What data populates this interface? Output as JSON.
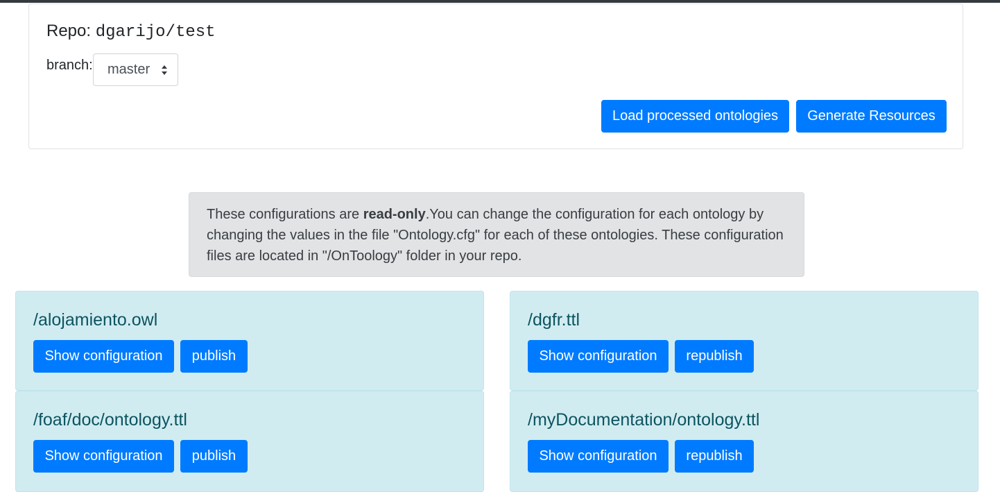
{
  "repo": {
    "label": "Repo:",
    "name": "dgarijo/test",
    "branch_label": "branch:",
    "branch_selected": "master",
    "load_button": "Load processed ontologies",
    "generate_button": "Generate Resources"
  },
  "notice": {
    "text_before": "These configurations are ",
    "bold": "read-only",
    "text_after": ".You can change the configuration for each ontology by changing the values in the file \"Ontology.cfg\" for each of these ontologies. These configuration files are located in \"/OnToology\" folder in your repo."
  },
  "ontologies": [
    {
      "path": "/alojamiento.owl",
      "show_label": "Show configuration",
      "action_label": "publish"
    },
    {
      "path": "/dgfr.ttl",
      "show_label": "Show configuration",
      "action_label": "republish"
    },
    {
      "path": "/foaf/doc/ontology.ttl",
      "show_label": "Show configuration",
      "action_label": "publish"
    },
    {
      "path": "/myDocumentation/ontology.ttl",
      "show_label": "Show configuration",
      "action_label": "republish"
    }
  ],
  "colors": {
    "primary": "#007bff",
    "info_bg": "#d1ecf1",
    "info_text": "#0c5460",
    "notice_bg": "#e2e3e5",
    "top_bar": "#343a40"
  }
}
